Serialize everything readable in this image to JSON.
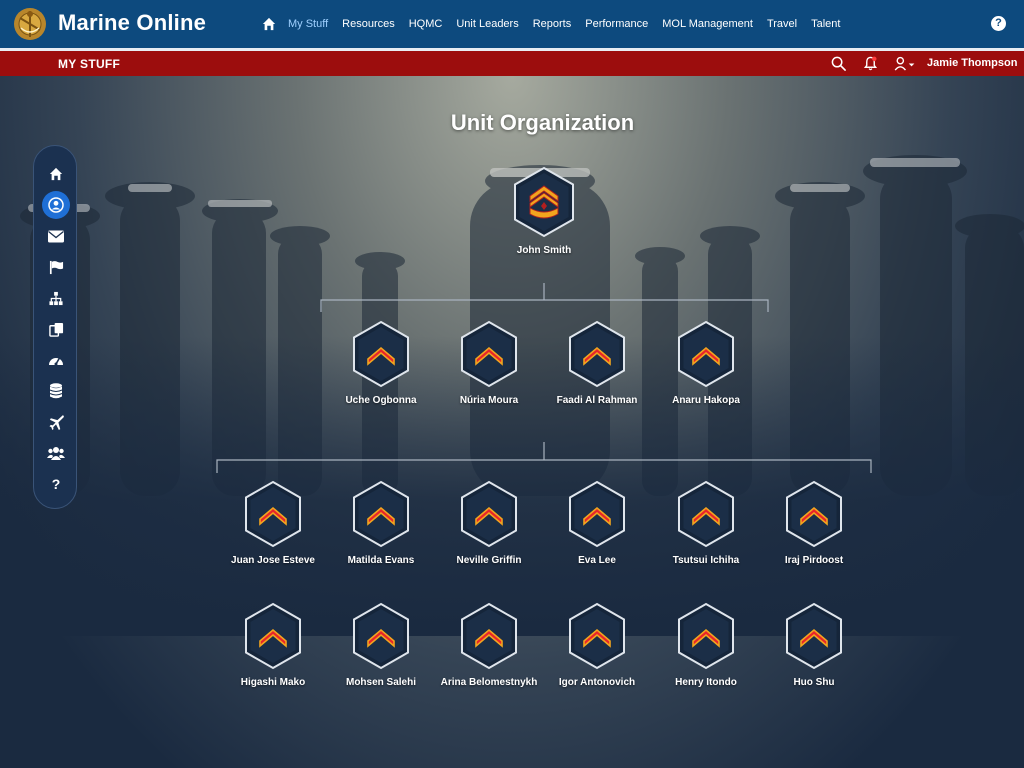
{
  "app": {
    "title": "Marine Online"
  },
  "nav": {
    "home_icon": "home-icon",
    "items": [
      {
        "label": "My Stuff",
        "active": true
      },
      {
        "label": "Resources",
        "active": false
      },
      {
        "label": "HQMC",
        "active": false
      },
      {
        "label": "Unit Leaders",
        "active": false
      },
      {
        "label": "Reports",
        "active": false
      },
      {
        "label": "Performance",
        "active": false
      },
      {
        "label": "MOL Management",
        "active": false
      },
      {
        "label": "Travel",
        "active": false
      },
      {
        "label": "Talent",
        "active": false
      }
    ],
    "help_label": "?"
  },
  "subbar": {
    "title": "MY STUFF",
    "user": "Jamie Thompson"
  },
  "page": {
    "title": "Unit Organization"
  },
  "sidebar": {
    "items": [
      "home-icon",
      "user-circle-icon",
      "envelope-icon",
      "flag-icon",
      "org-chart-icon",
      "documents-icon",
      "dashboard-icon",
      "database-icon",
      "plane-icon",
      "users-icon",
      "question-icon"
    ],
    "active_index": 1,
    "help_label": "?"
  },
  "org": {
    "leader": {
      "name": "John Smith",
      "rank_icon": "gunnery-sergeant-insignia-icon"
    },
    "tier2": [
      {
        "name": "Uche Ogbonna"
      },
      {
        "name": "Núria Moura"
      },
      {
        "name": "Faadi Al Rahman"
      },
      {
        "name": "Anaru Hakopa"
      }
    ],
    "tier3_row1": [
      {
        "name": "Juan Jose Esteve"
      },
      {
        "name": "Matilda Evans"
      },
      {
        "name": "Neville Griffin"
      },
      {
        "name": "Eva Lee"
      },
      {
        "name": "Tsutsui Ichiha"
      },
      {
        "name": "Iraj Pirdoost"
      }
    ],
    "tier3_row2": [
      {
        "name": "Higashi Mako"
      },
      {
        "name": "Mohsen Salehi"
      },
      {
        "name": "Arina Belomestnykh"
      },
      {
        "name": "Igor Antonovich"
      },
      {
        "name": "Henry Itondo"
      },
      {
        "name": "Huo Shu"
      }
    ]
  },
  "colors": {
    "nav_bg": "#0d4a7e",
    "subbar_bg": "#9c0d0d",
    "accent": "#1f6fd6",
    "chevron": "#e8252a",
    "chevron_gold": "#f2a51e"
  }
}
